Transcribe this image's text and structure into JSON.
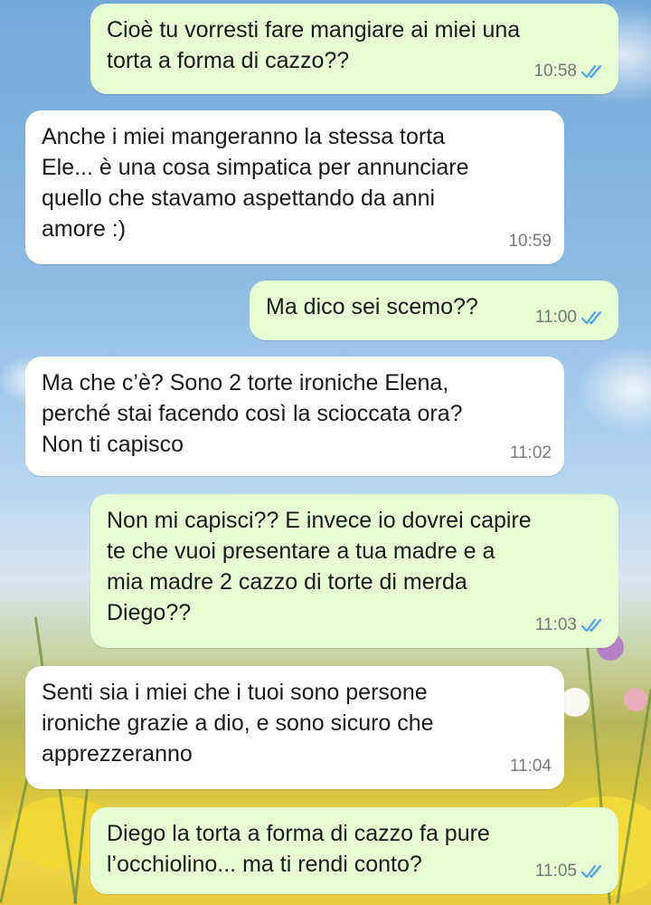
{
  "colors": {
    "outgoing_bubble": "#e7fdd4",
    "incoming_bubble": "#ffffff",
    "read_ticks": "#4fa3e6"
  },
  "messages": [
    {
      "direction": "out",
      "text": "Cioè tu vorresti fare mangiare ai miei una\ntorta a forma di cazzo??",
      "time": "10:58",
      "status": "read-ticks-icon"
    },
    {
      "direction": "in",
      "text": "Anche i miei mangeranno la stessa torta\nEle... è una cosa simpatica per annunciare\nquello che stavamo aspettando da anni\namore :)",
      "time": "10:59"
    },
    {
      "direction": "out",
      "text": "Ma dico sei scemo??",
      "time": "11:00",
      "status": "read-ticks-icon"
    },
    {
      "direction": "in",
      "text": "Ma che c’è? Sono 2 torte ironiche Elena,\nperché stai facendo così la scioccata ora?\nNon ti capisco",
      "time": "11:02"
    },
    {
      "direction": "out",
      "text": "Non mi capisci?? E invece io dovrei capire\nte che vuoi presentare a tua madre e a\nmia madre 2 cazzo di torte di merda\nDiego??",
      "time": "11:03",
      "status": "read-ticks-icon"
    },
    {
      "direction": "in",
      "text": "Senti sia i miei che i tuoi sono persone\nironiche grazie a dio, e sono sicuro che\napprezzeranno",
      "time": "11:04"
    },
    {
      "direction": "out",
      "text": "Diego la torta a forma di cazzo fa pure\nl’occhiolino... ma ti rendi conto?",
      "time": "11:05",
      "status": "read-ticks-icon"
    }
  ]
}
